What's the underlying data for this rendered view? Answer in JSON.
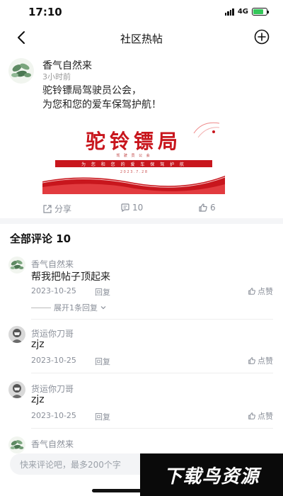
{
  "status_bar": {
    "time": "17:10",
    "network": "4G"
  },
  "nav": {
    "title": "社区热帖"
  },
  "post": {
    "author": "香气自然来",
    "time_ago": "3小时前",
    "text_line1": "驼铃镖局驾驶员公会，",
    "text_line2": "为您和您的爱车保驾护航！",
    "image": {
      "title": "驼铃镖局",
      "subtitle": "驾 驶 员 公 会",
      "banner": "为 您 和 您 的 爱 车 保 驾 护 航",
      "small_date": "2 0 2 3 . 7 . 2 8"
    },
    "share_label": "分享",
    "comment_count": "10",
    "like_count": "6"
  },
  "comments_section": {
    "title": "全部评论 10",
    "comments": [
      {
        "author": "香气自然来",
        "text": "帮我把帖子顶起来",
        "date": "2023-10-25",
        "reply_label": "回复",
        "like_label": "点赞",
        "expand_label": "展开1条回复"
      },
      {
        "author": "货运你刀哥",
        "text": "zjz",
        "date": "2023-10-25",
        "reply_label": "回复",
        "like_label": "点赞"
      },
      {
        "author": "货运你刀哥",
        "text": "zjz",
        "date": "2023-10-25",
        "reply_label": "回复",
        "like_label": "点赞"
      },
      {
        "author": "香气自然来",
        "text": "",
        "date": "",
        "reply_label": "",
        "like_label": ""
      }
    ]
  },
  "input": {
    "placeholder": "快来评论吧，最多200个字"
  },
  "watermark": {
    "text": "下载鸟资源"
  },
  "colors": {
    "accent_red": "#c8161d",
    "muted": "#8a8f99",
    "battery": "#34c759"
  }
}
